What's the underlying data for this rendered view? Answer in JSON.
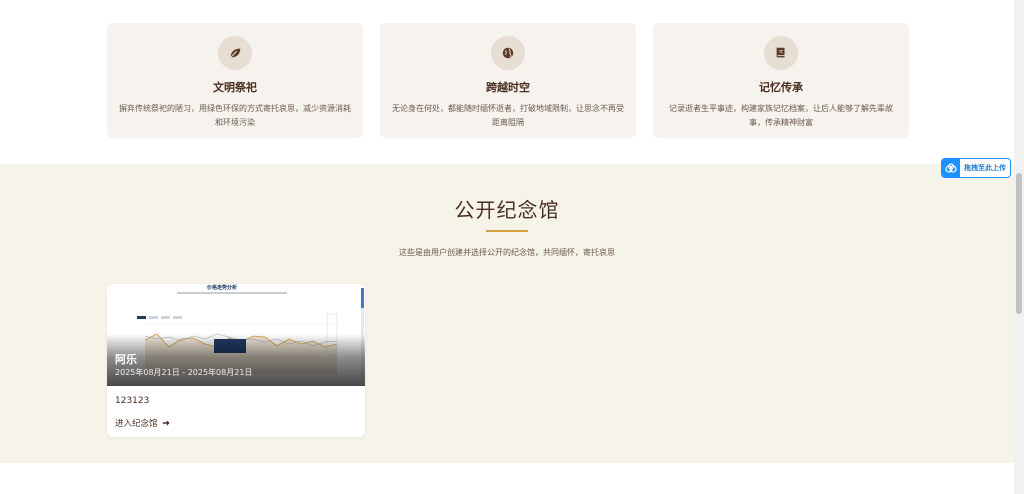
{
  "features": [
    {
      "icon": "leaf-icon",
      "title": "文明祭祀",
      "desc": "摒弃传统祭祀的陋习，用绿色环保的方式寄托哀思，减少资源消耗和环境污染"
    },
    {
      "icon": "globe-icon",
      "title": "跨越时空",
      "desc": "无论身在何处，都能随时缅怀逝者，打破地域限制，让思念不再受距离阻隔"
    },
    {
      "icon": "book-icon",
      "title": "记忆传承",
      "desc": "记录逝者生平事迹，构建家族记忆档案，让后人能够了解先辈故事，传承精神财富"
    }
  ],
  "public_section": {
    "title": "公开纪念馆",
    "subtitle": "这些是由用户创建并选择公开的纪念馆，共同缅怀，寄托哀思"
  },
  "memorial_card": {
    "image_title": "价格走势分析",
    "name": "阿乐",
    "date_range": "2025年08月21日 - 2025年08月21日",
    "description": "123123",
    "link_label": "进入纪念馆"
  },
  "upload_button": {
    "label": "拖拽至此上传"
  },
  "colors": {
    "brand_brown": "#4a2e22",
    "accent_gold": "#d4a23c",
    "section_bg": "#f6f3e8",
    "card_bg": "#f6f2ed",
    "upload_blue": "#1e90ff"
  }
}
